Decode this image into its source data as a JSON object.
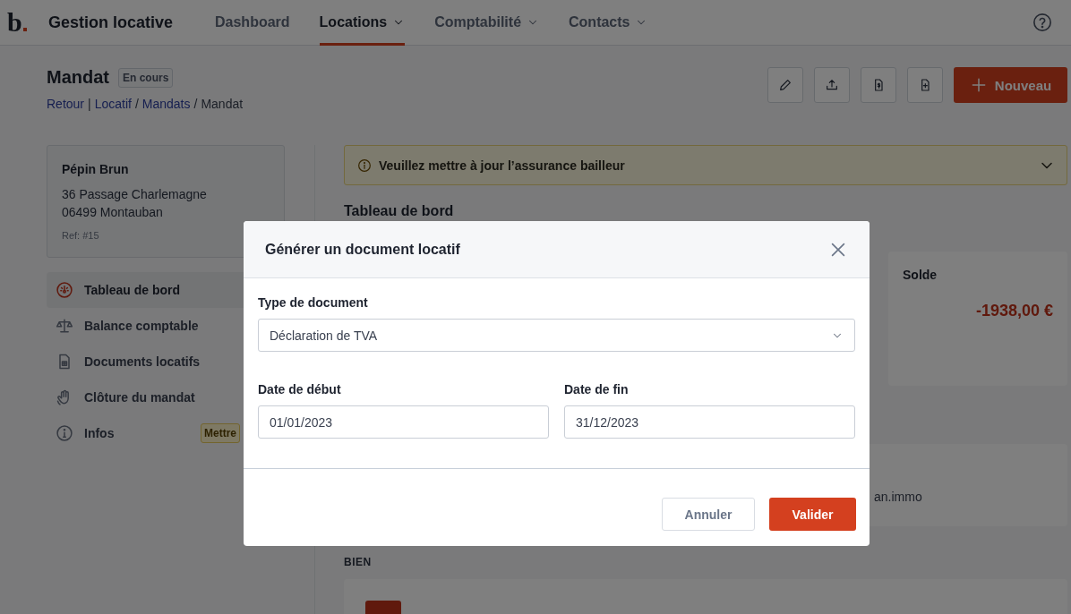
{
  "header": {
    "logo": "b",
    "app_title": "Gestion locative",
    "nav": [
      {
        "label": "Dashboard",
        "selected": false,
        "dropdown": false
      },
      {
        "label": "Locations",
        "selected": true,
        "dropdown": true
      },
      {
        "label": "Comptabilité",
        "selected": false,
        "dropdown": true
      },
      {
        "label": "Contacts",
        "selected": false,
        "dropdown": true
      }
    ]
  },
  "page": {
    "title": "Mandat",
    "status": "En cours",
    "breadcrumb": [
      {
        "label": "Retour",
        "kind": "link"
      },
      {
        "label": "|",
        "kind": "separator"
      },
      {
        "label": "Locatif",
        "kind": "link"
      },
      {
        "label": "/",
        "kind": "separator"
      },
      {
        "label": "Mandats",
        "kind": "link"
      },
      {
        "label": "/",
        "kind": "separator"
      },
      {
        "label": "Mandat",
        "kind": "current"
      }
    ],
    "new_button": "Nouveau"
  },
  "owner_card": {
    "name": "Pépin Brun",
    "address_lines": [
      "36 Passage Charlemagne",
      "06499 Montauban"
    ],
    "ref": "Ref: #15"
  },
  "sidebar": [
    {
      "label": "Tableau de bord",
      "selected": true
    },
    {
      "label": "Balance comptable",
      "selected": false
    },
    {
      "label": "Documents locatifs",
      "selected": false
    },
    {
      "label": "Clôture du mandat",
      "selected": false
    },
    {
      "label": "Infos",
      "selected": false,
      "badge": "Mettre"
    }
  ],
  "alert": {
    "message": "Veuillez mettre à jour l’assurance bailleur"
  },
  "dashboard": {
    "heading": "Tableau de bord",
    "balance": {
      "label": "Solde",
      "amount": "-1938,00 €"
    }
  },
  "contact_card": {
    "text": "an.immo"
  },
  "property_section": {
    "heading": "BIEN"
  },
  "modal": {
    "title": "Générer un document locatif",
    "type_field": {
      "label": "Type de document",
      "value": "Déclaration de TVA"
    },
    "start_field": {
      "label": "Date de début",
      "value": "01/01/2023"
    },
    "end_field": {
      "label": "Date de fin",
      "value": "31/12/2023"
    },
    "cancel": "Annuler",
    "submit": "Valider"
  }
}
